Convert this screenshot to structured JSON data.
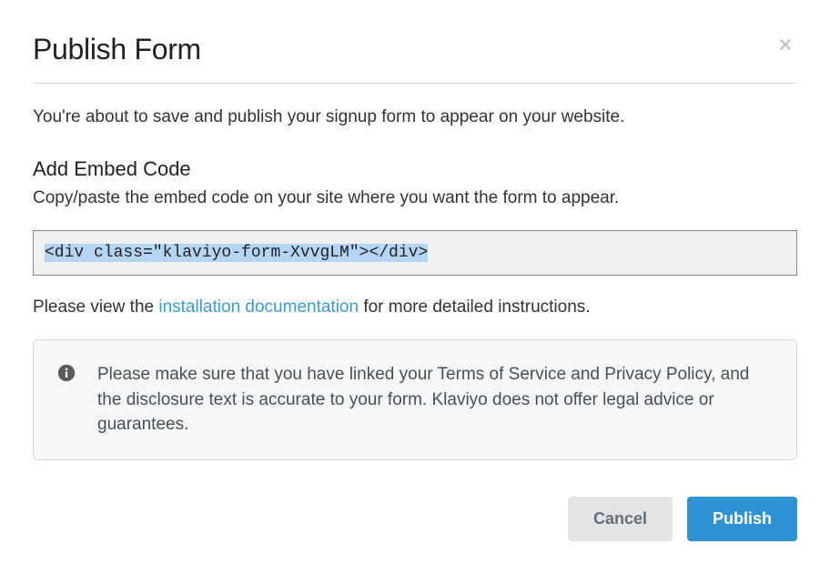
{
  "modal": {
    "title": "Publish Form",
    "intro": "You're about to save and publish your signup form to appear on your website.",
    "embed": {
      "heading": "Add Embed Code",
      "desc": "Copy/paste the embed code on your site where you want the form to appear.",
      "code": "<div class=\"klaviyo-form-XvvgLM\"></div>"
    },
    "help": {
      "prefix": "Please view the ",
      "link_label": "installation documentation",
      "suffix": " for more detailed instructions."
    },
    "callout": {
      "text": "Please make sure that you have linked your Terms of Service and Privacy Policy, and the disclosure text is accurate to your form. Klaviyo does not offer legal advice or guarantees."
    },
    "buttons": {
      "cancel": "Cancel",
      "publish": "Publish"
    }
  }
}
